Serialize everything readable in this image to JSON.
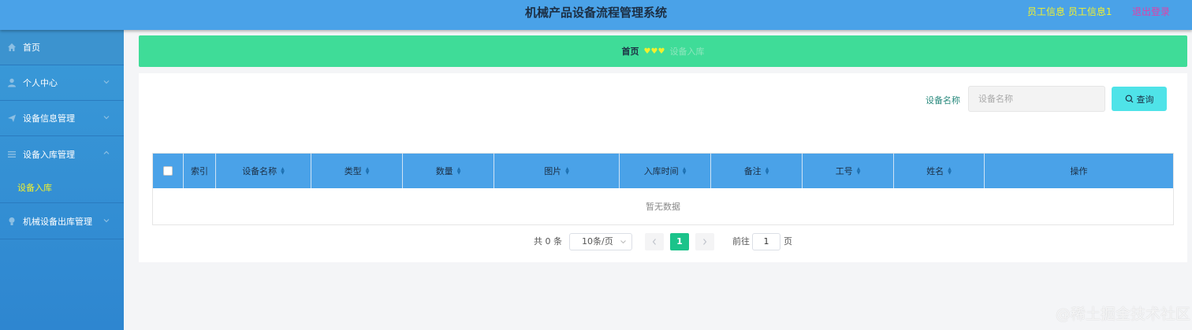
{
  "header": {
    "title": "机械产品设备流程管理系统",
    "user_info": "员工信息 员工信息1",
    "logout": "退出登录"
  },
  "sidebar": {
    "items": [
      {
        "label": "首页",
        "icon": "home-icon"
      },
      {
        "label": "个人中心",
        "icon": "user-icon"
      },
      {
        "label": "设备信息管理",
        "icon": "send-icon"
      },
      {
        "label": "设备入库管理",
        "icon": "list-icon"
      },
      {
        "label": "机械设备出库管理",
        "icon": "bulb-icon"
      }
    ],
    "sub_item": "设备入库",
    "colors": {
      "background": "#3a9ad8",
      "active_sub": "#f1f02d"
    }
  },
  "breadcrumb": {
    "home": "首页",
    "separator": "♥♥♥",
    "current": "设备入库"
  },
  "search": {
    "label": "设备名称",
    "placeholder": "设备名称",
    "button": "查询"
  },
  "table": {
    "columns": [
      "索引",
      "设备名称",
      "类型",
      "数量",
      "图片",
      "入库时间",
      "备注",
      "工号",
      "姓名",
      "操作"
    ],
    "empty_text": "暂无数据"
  },
  "pagination": {
    "total": "共 0 条",
    "page_size": "10条/页",
    "current_page": "1",
    "goto_label": "前往",
    "goto_value": "1",
    "page_suffix": "页"
  },
  "watermark": "@稀土掘金技术社区",
  "colors": {
    "header": "#4aa2e8",
    "breadcrumb": "#3fdc98",
    "table_header": "#4aa2e8",
    "search_button": "#4fe3e8",
    "page_active": "#1bc38a"
  }
}
